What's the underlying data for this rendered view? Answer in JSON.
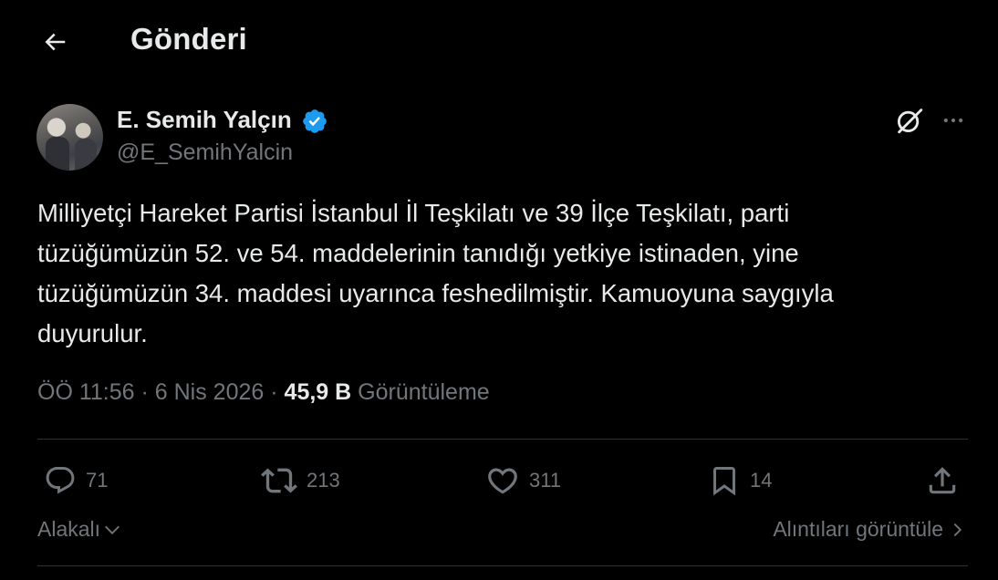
{
  "header": {
    "title": "Gönderi"
  },
  "author": {
    "display_name": "E. Semih Yalçın",
    "handle": "@E_SemihYalcin",
    "verified_color": "#1d9bf0"
  },
  "tweet": {
    "text": "Milliyetçi Hareket Partisi İstanbul İl Teşkilatı ve 39 İlçe Teşkilatı, parti\ntüzüğümüzün 52. ve 54. maddelerinin tanıdığı yetkiye istinaden, yine\ntüzüğümüzün 34. maddesi uyarınca feshedilmiştir. Kamuoyuna saygıyla\nduyurulur.",
    "time": "ÖÖ 11:56",
    "separator": "·",
    "date": "6 Nis 2026",
    "views_count": "45,9 B",
    "views_label": "Görüntüleme"
  },
  "actions": {
    "replies": "71",
    "retweets": "213",
    "likes": "311",
    "bookmarks": "14"
  },
  "footer": {
    "related_label": "Alakalı",
    "quotes_label": "Alıntıları görüntüle"
  },
  "icons": {
    "back": "arrow-left-icon",
    "verified": "verified-badge-icon",
    "grok": "grok-icon",
    "more": "more-horizontal-icon",
    "reply": "reply-icon",
    "retweet": "retweet-icon",
    "like": "heart-icon",
    "bookmark": "bookmark-icon",
    "share": "share-icon"
  }
}
